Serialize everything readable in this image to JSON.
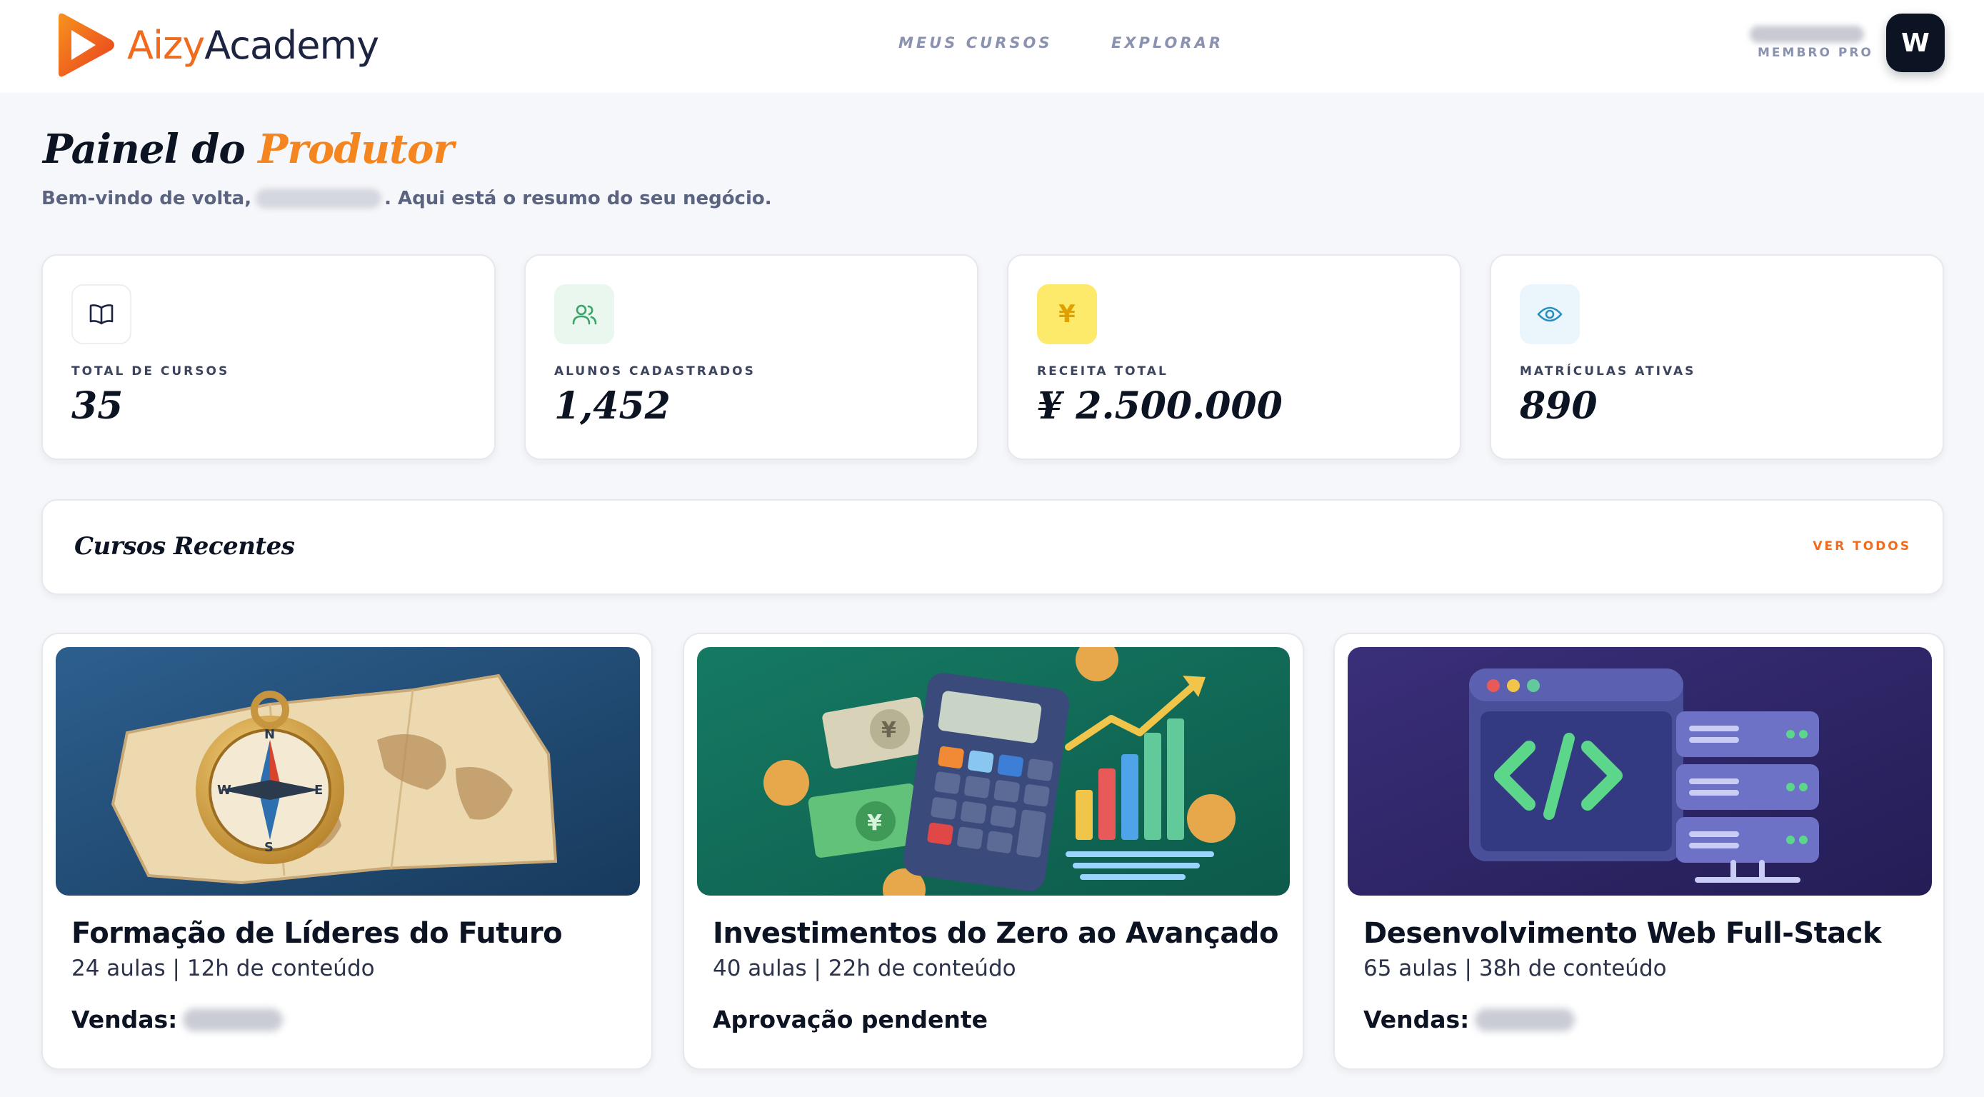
{
  "brand": {
    "name_part1": "Aizy",
    "name_part2": "Academy"
  },
  "nav": {
    "my_courses": "MEUS CURSOS",
    "explore": "EXPLORAR"
  },
  "user": {
    "role": "MEMBRO PRO",
    "avatar_letter": "W"
  },
  "page": {
    "title_part1": "Painel do ",
    "title_part2": "Produtor",
    "welcome_prefix": "Bem-vindo de volta,",
    "welcome_suffix": ". Aqui está o resumo do seu negócio."
  },
  "stats": [
    {
      "label": "TOTAL DE CURSOS",
      "value": "35",
      "icon": "book-icon",
      "icon_color": "#1c2442",
      "icon_bg": "#ffffff"
    },
    {
      "label": "ALUNOS CADASTRADOS",
      "value": "1,452",
      "icon": "users-icon",
      "icon_color": "#3aa56b",
      "icon_bg": "#eaf7ef"
    },
    {
      "label": "RECEITA TOTAL",
      "value": "¥ 2.500.000",
      "icon": "yen-icon",
      "icon_color": "#e0a100",
      "icon_bg": "#fde96a"
    },
    {
      "label": "MATRÍCULAS ATIVAS",
      "value": "890",
      "icon": "eye-icon",
      "icon_color": "#2a8fbf",
      "icon_bg": "#eaf6fb"
    }
  ],
  "recent": {
    "title": "Cursos Recentes",
    "see_all": "VER TODOS"
  },
  "courses": [
    {
      "title": "Formação de Líderes do Futuro",
      "meta": "24 aulas | 12h de conteúdo",
      "status": "Vendas:",
      "thumb": "compass-map-thumbnail"
    },
    {
      "title": "Investimentos do Zero ao Avançado",
      "meta": "40 aulas | 22h de conteúdo",
      "status": "Aprovação pendente",
      "thumb": "finance-calculator-thumbnail"
    },
    {
      "title": "Desenvolvimento Web Full-Stack",
      "meta": "65 aulas | 38h de conteúdo",
      "status": "Vendas:",
      "thumb": "code-server-thumbnail"
    }
  ],
  "colors": {
    "accent": "#f26a1b",
    "accent_title": "#f5851f",
    "dark": "#0c1322",
    "muted": "#8b92b0"
  }
}
